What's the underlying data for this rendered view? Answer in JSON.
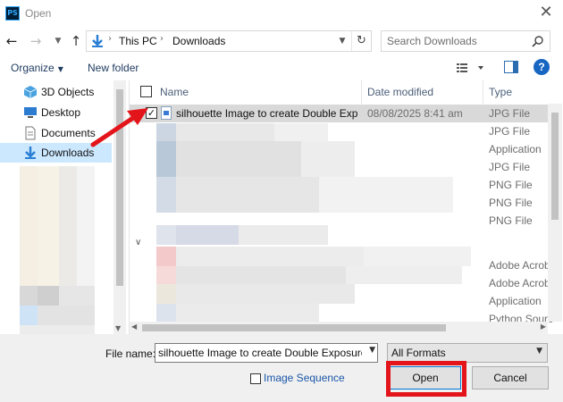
{
  "window": {
    "title": "Open",
    "app_icon": "PS"
  },
  "nav": {
    "breadcrumb": [
      "This PC",
      "Downloads"
    ],
    "search_placeholder": "Search Downloads"
  },
  "toolbar": {
    "organize_label": "Organize",
    "new_folder_label": "New folder",
    "help_label": "?"
  },
  "sidebar": {
    "items": [
      {
        "label": "3D Objects",
        "icon": "cube-icon"
      },
      {
        "label": "Desktop",
        "icon": "desktop-icon"
      },
      {
        "label": "Documents",
        "icon": "documents-icon"
      },
      {
        "label": "Downloads",
        "icon": "download-arrow-icon",
        "selected": true
      }
    ]
  },
  "columns": {
    "name": "Name",
    "date": "Date modified",
    "type": "Type"
  },
  "selected_file": {
    "name": "silhouette Image to create Double Exp...",
    "date": "08/08/2025 8:41 am",
    "type": "JPG File",
    "checked": "✓"
  },
  "types": [
    "JPG File",
    "Application",
    "JPG File",
    "PNG File",
    "PNG File",
    "PNG File",
    "Adobe Acrob",
    "Adobe Acrob",
    "Application",
    "Python Sourc"
  ],
  "bottom": {
    "file_name_label": "File name:",
    "file_name_value": "silhouette Image to create Double Exposure in",
    "format_value": "All Formats",
    "image_sequence_label": "Image Sequence",
    "open_label": "Open",
    "cancel_label": "Cancel"
  },
  "colors": {
    "highlight": "#e3141a",
    "selection": "#cce8ff",
    "accent": "#0078d7"
  }
}
